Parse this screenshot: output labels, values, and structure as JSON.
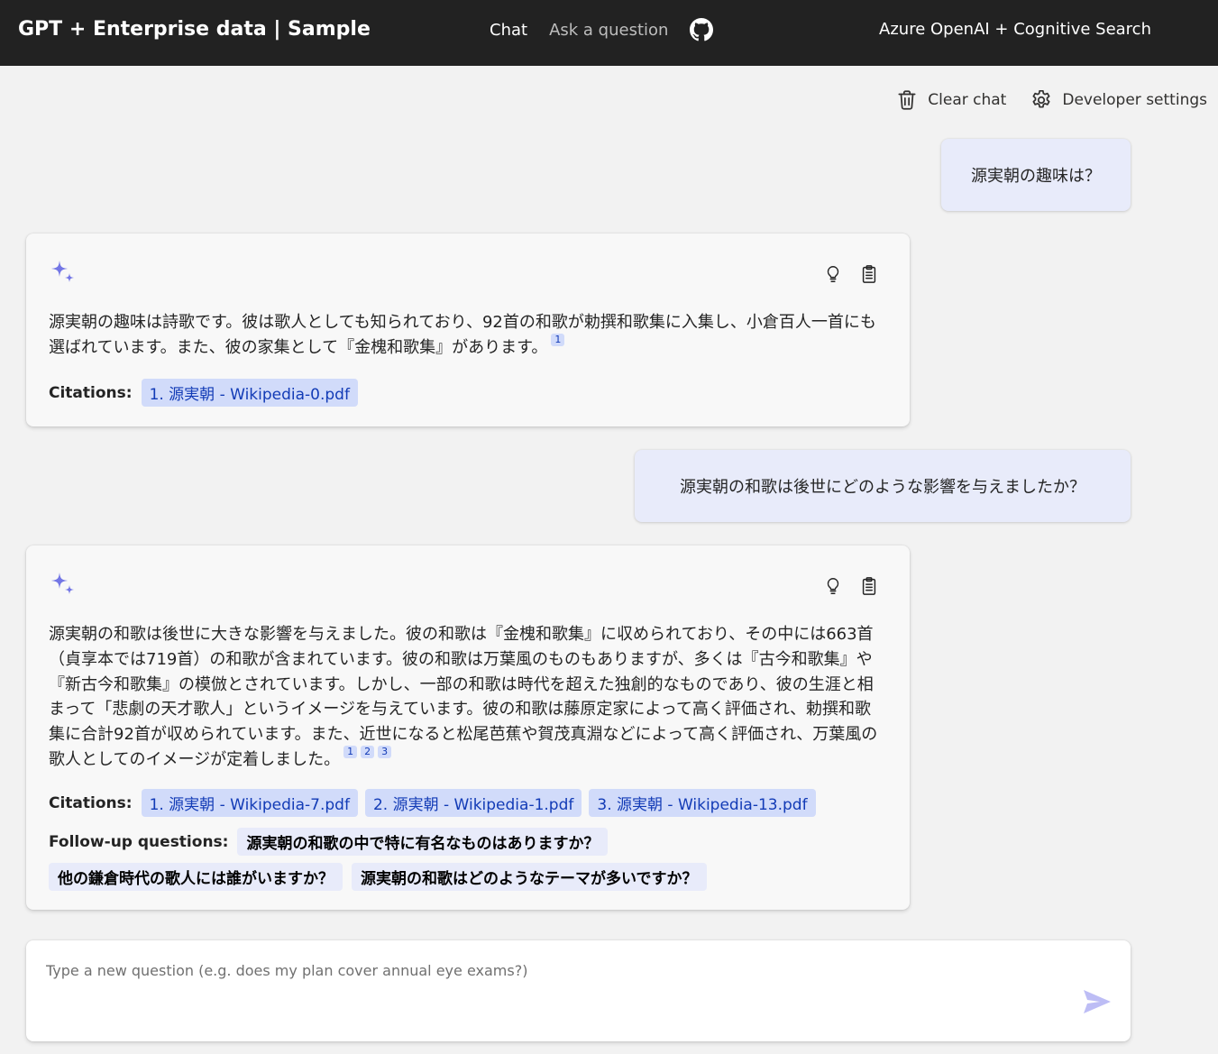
{
  "header": {
    "title": "GPT + Enterprise data | Sample",
    "nav": {
      "chat": "Chat",
      "ask": "Ask a question"
    },
    "right_title": "Azure OpenAI + Cognitive Search"
  },
  "commands": {
    "clear_chat": "Clear chat",
    "developer_settings": "Developer settings"
  },
  "conversation": [
    {
      "question": "源実朝の趣味は？",
      "answer": "源実朝の趣味は詩歌です。彼は歌人としても知られており、92首の和歌が勅撰和歌集に入集し、小倉百人一首にも選ばれています。また、彼の家集として『金槐和歌集』があります。",
      "markers": [
        "1"
      ],
      "citations_label": "Citations:",
      "citations": [
        "1. 源実朝 - Wikipedia-0.pdf"
      ]
    },
    {
      "question": "源実朝の和歌は後世にどのような影響を与えましたか？",
      "answer": "源実朝の和歌は後世に大きな影響を与えました。彼の和歌は『金槐和歌集』に収められており、その中には663首（貞享本では719首）の和歌が含まれています。彼の和歌は万葉風のものもありますが、多くは『古今和歌集』や『新古今和歌集』の模倣とされています。しかし、一部の和歌は時代を超えた独創的なものであり、彼の生涯と相まって「悲劇の天才歌人」というイメージを与えています。彼の和歌は藤原定家によって高く評価され、勅撰和歌集に合計92首が収められています。また、近世になると松尾芭蕉や賀茂真淵などによって高く評価され、万葉風の歌人としてのイメージが定着しました。",
      "markers": [
        "1",
        "2",
        "3"
      ],
      "citations_label": "Citations:",
      "citations": [
        "1. 源実朝 - Wikipedia-7.pdf",
        "2. 源実朝 - Wikipedia-1.pdf",
        "3. 源実朝 - Wikipedia-13.pdf"
      ],
      "followup_label": "Follow-up questions:",
      "followups": [
        "源実朝の和歌の中で特に有名なものはありますか？",
        "他の鎌倉時代の歌人には誰がいますか？",
        "源実朝の和歌はどのようなテーマが多いですか？"
      ]
    }
  ],
  "input": {
    "placeholder": "Type a new question (e.g. does my plan cover annual eye exams?)",
    "value": ""
  },
  "icons": {
    "github": "github-icon",
    "trash": "trash-icon",
    "settings": "gear-icon",
    "sparkle": "sparkle-icon",
    "lightbulb": "lightbulb-icon",
    "clipboard": "clipboard-icon",
    "send": "send-icon"
  },
  "colors": {
    "header_bg": "#222222",
    "page_bg": "#f2f2f2",
    "user_bubble": "#e8ebfa",
    "citation_bg": "#d1dbfa",
    "citation_text": "#123bb6",
    "sparkle": "#7376e5",
    "send": "#bdbdf5"
  }
}
